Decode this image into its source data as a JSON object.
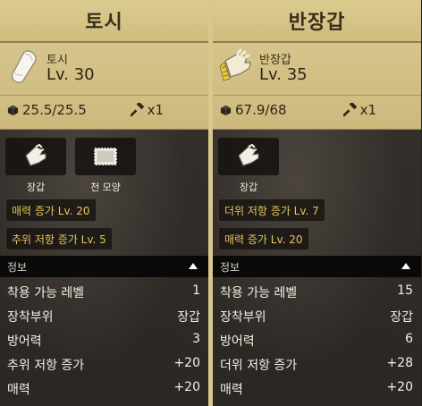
{
  "left": {
    "title": "토시",
    "item_name": "토시",
    "item_level": "Lv. 30",
    "durability": "25.5/25.5",
    "repair_count": "x1",
    "item_icon": "sleeve-icon",
    "tags": [
      {
        "label": "장갑",
        "icon": "glove-icon"
      },
      {
        "label": "천 모양",
        "icon": "cloth-icon"
      }
    ],
    "bonuses": [
      "매력 증가 Lv. 20",
      "추위 저항 증가 Lv. 5"
    ],
    "info_label": "정보",
    "stats": [
      {
        "name": "착용 가능 레벨",
        "value": "1"
      },
      {
        "name": "장착부위",
        "value": "장갑"
      },
      {
        "name": "방어력",
        "value": "3"
      },
      {
        "name": "추위 저항 증가",
        "value": "+20"
      },
      {
        "name": "매력",
        "value": "+20"
      }
    ]
  },
  "right": {
    "title": "반장갑",
    "item_name": "반장갑",
    "item_level": "Lv. 35",
    "durability": "67.9/68",
    "repair_count": "x1",
    "item_icon": "half-glove-icon",
    "tags": [
      {
        "label": "장갑",
        "icon": "glove-icon"
      }
    ],
    "bonuses": [
      "더위 저항 증가 Lv. 7",
      "매력 증가 Lv. 20"
    ],
    "info_label": "정보",
    "stats": [
      {
        "name": "착용 가능 레벨",
        "value": "15"
      },
      {
        "name": "장착부위",
        "value": "장갑"
      },
      {
        "name": "방어력",
        "value": "6"
      },
      {
        "name": "더위 저항 증가",
        "value": "+28"
      },
      {
        "name": "매력",
        "value": "+20"
      }
    ]
  },
  "colors": {
    "title_bg": "#dccb8f",
    "card_bg": "#d6c48c",
    "bonus_text": "#e8c45a",
    "stat_text": "#f4f0e6"
  }
}
